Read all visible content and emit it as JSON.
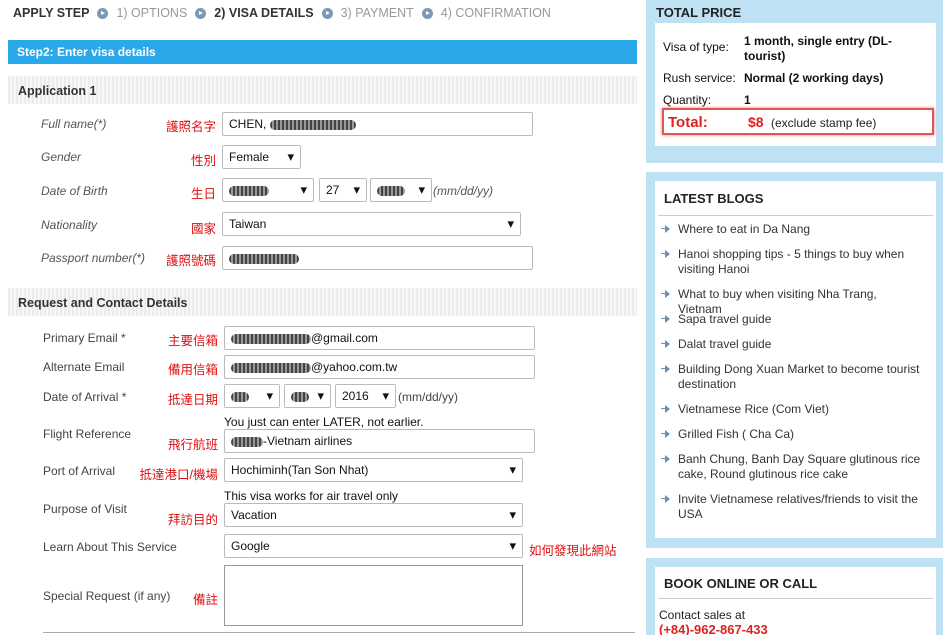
{
  "steps": [
    {
      "label": "APPLY STEP",
      "state": "heading"
    },
    {
      "label": "1) OPTIONS",
      "state": "done"
    },
    {
      "label": "2) VISA DETAILS",
      "state": "current"
    },
    {
      "label": "3) PAYMENT",
      "state": "todo"
    },
    {
      "label": "4) CONFIRMATION",
      "state": "todo"
    }
  ],
  "banner": "Step2: Enter visa details",
  "application": {
    "title": "Application 1",
    "full_name": {
      "label": "Full name(*)",
      "zh": "護照名字",
      "value": "CHEN, "
    },
    "gender": {
      "label": "Gender",
      "zh": "性別",
      "value": "Female"
    },
    "dob": {
      "label": "Date of Birth",
      "zh": "生日",
      "day": "27",
      "format": "(mm/dd/yy)"
    },
    "nationality": {
      "label": "Nationality",
      "zh": "國家",
      "value": "Taiwan"
    },
    "passport": {
      "label": "Passport number(*)",
      "zh": "護照號碼"
    }
  },
  "contact": {
    "title": "Request and Contact Details",
    "primary_email": {
      "label": "Primary Email *",
      "zh": "主要信箱",
      "value_suffix": "@gmail.com"
    },
    "alternate_email": {
      "label": "Alternate Email",
      "zh": "備用信箱",
      "value_suffix": "@yahoo.com.tw"
    },
    "arrival_date": {
      "label": "Date of Arrival *",
      "zh": "抵達日期",
      "year": "2016",
      "format": "(mm/dd/yy)"
    },
    "arrival_note": "You just can enter LATER, not earlier.",
    "flight": {
      "label": "Flight Reference",
      "zh": "飛行航班",
      "value_suffix": "-Vietnam airlines"
    },
    "port": {
      "label": "Port of Arrival",
      "zh": "抵達港口/機場",
      "value": "Hochiminh(Tan Son Nhat)"
    },
    "port_note": "This visa works for air travel only",
    "purpose": {
      "label": "Purpose of Visit",
      "zh": "拜訪目的",
      "value": "Vacation"
    },
    "learn": {
      "label": "Learn About This Service",
      "zh": "如何發現此網站",
      "value": "Google"
    },
    "special": {
      "label": "Special Request (if any)",
      "zh": "備註"
    }
  },
  "sidebar": {
    "total_price": {
      "title": "TOTAL PRICE",
      "visa_type_label": "Visa of type:",
      "visa_type_value": "1 month, single entry (DL-tourist)",
      "rush_label": "Rush service:",
      "rush_value": "Normal (2 working days)",
      "quantity_label": "Quantity:",
      "quantity_value": "1",
      "total_label": "Total:",
      "total_value": "$8",
      "total_note": "(exclude stamp fee)"
    },
    "blogs": {
      "title": "LATEST BLOGS",
      "items": [
        "Where to eat in Da Nang",
        "Hanoi shopping tips - 5 things to buy when visiting Hanoi",
        "What to buy when visiting Nha Trang, Vietnam",
        "Sapa travel guide",
        "Dalat travel guide",
        "Building Dong Xuan Market to become tourist destination",
        "Vietnamese Rice (Com Viet)",
        "Grilled Fish ( Cha Ca)",
        "Banh Chung, Banh Day Square glutinous rice cake, Round glutinous rice cake",
        "Invite Vietnamese relatives/friends to visit the USA"
      ]
    },
    "book": {
      "title": "BOOK ONLINE OR CALL",
      "contact_label": "Contact sales at",
      "phone": "(+84)-962-867-433"
    }
  },
  "colors": {
    "accent": "#29a9ea",
    "sidebar_bg": "#bfe1f4",
    "red": "#dd1111"
  }
}
